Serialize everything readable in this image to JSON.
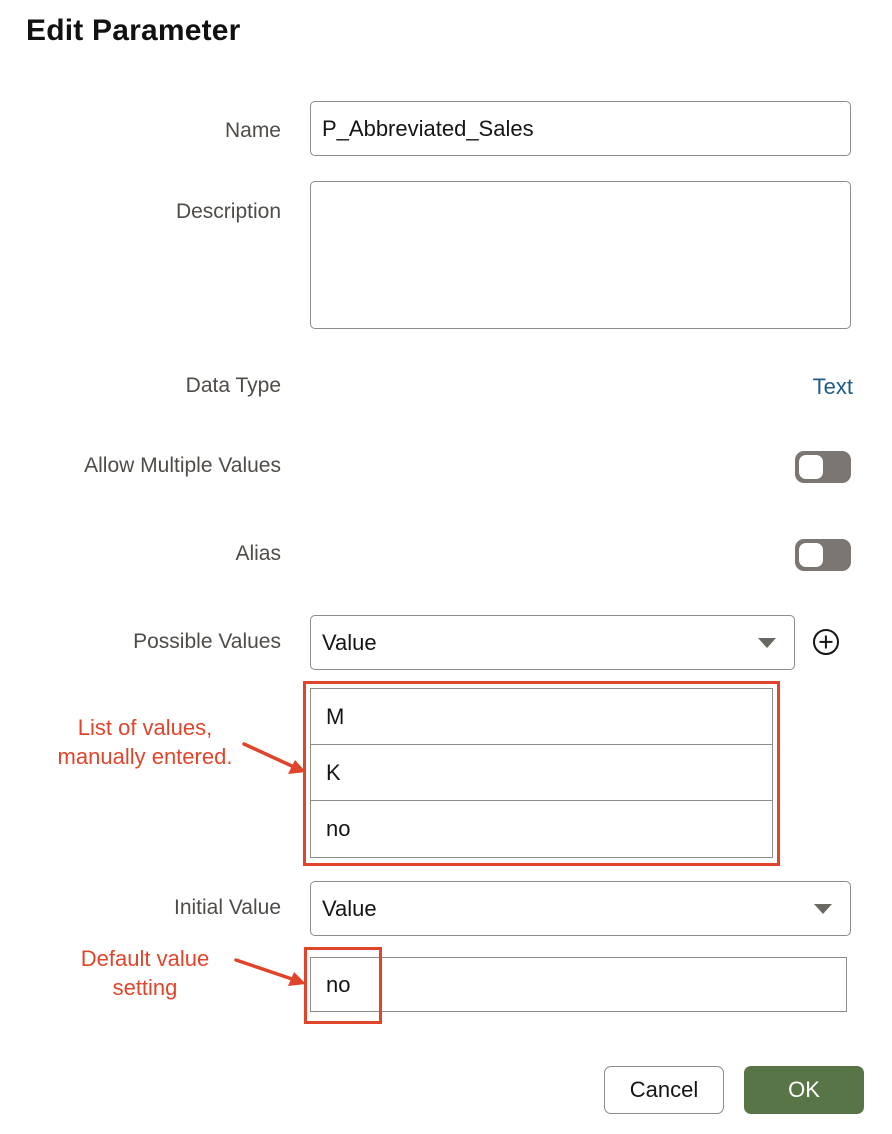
{
  "dialog": {
    "title": "Edit Parameter"
  },
  "form": {
    "name": {
      "label": "Name",
      "value": "P_Abbreviated_Sales"
    },
    "description": {
      "label": "Description",
      "value": ""
    },
    "data_type": {
      "label": "Data Type",
      "value": "Text"
    },
    "allow_multiple_values": {
      "label": "Allow Multiple Values",
      "enabled": false
    },
    "alias": {
      "label": "Alias",
      "enabled": false
    },
    "possible_values": {
      "label": "Possible Values",
      "selected": "Value",
      "items": [
        "M",
        "K",
        "no"
      ]
    },
    "initial_value": {
      "label": "Initial Value",
      "selected": "Value",
      "value": "no"
    }
  },
  "annotations": {
    "list_note": [
      "List of values,",
      "manually entered."
    ],
    "default_note": [
      "Default value",
      "setting"
    ],
    "color": "#e0452b"
  },
  "buttons": {
    "cancel": "Cancel",
    "ok": "OK"
  },
  "colors": {
    "ok_button": "#587548",
    "link_text": "#1f5d85",
    "toggle_off": "#7b7671"
  },
  "icons": {
    "add": "plus-circle-icon",
    "dropdown": "caret-down-icon"
  }
}
